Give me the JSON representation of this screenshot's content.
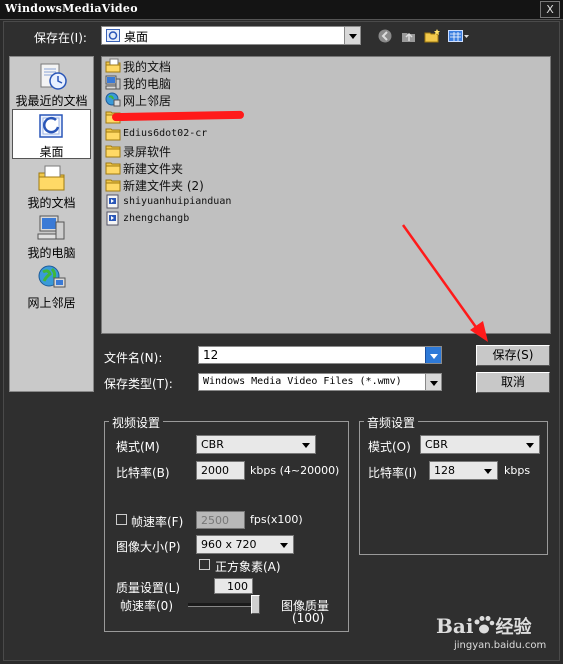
{
  "window": {
    "title": "WindowsMediaVideo",
    "close": "X"
  },
  "save_in": {
    "label": "保存在(I):",
    "value": "桌面",
    "toolbar_icons": [
      "back-arrow-icon",
      "up-folder-icon",
      "new-folder-icon",
      "view-menu-icon"
    ]
  },
  "sidebar": {
    "items": [
      {
        "label": "我最近的文档",
        "icon": "recent-documents-icon"
      },
      {
        "label": "桌面",
        "icon": "desktop-icon",
        "selected": true
      },
      {
        "label": "我的文档",
        "icon": "my-documents-icon"
      },
      {
        "label": "我的电脑",
        "icon": "my-computer-icon"
      },
      {
        "label": "网上邻居",
        "icon": "network-icon"
      }
    ]
  },
  "files": [
    {
      "name": "我的文档",
      "icon": "my-documents-icon"
    },
    {
      "name": "我的电脑",
      "icon": "my-computer-icon"
    },
    {
      "name": "网上邻居",
      "icon": "network-icon"
    },
    {
      "name": "",
      "icon": "folder-icon"
    },
    {
      "name": "Edius6dot02-cr",
      "icon": "folder-icon"
    },
    {
      "name": "录屏软件",
      "icon": "folder-icon"
    },
    {
      "name": "新建文件夹",
      "icon": "folder-icon"
    },
    {
      "name": "新建文件夹 (2)",
      "icon": "folder-icon"
    },
    {
      "name": "shiyuanhuipianduan",
      "icon": "wmv-file-icon"
    },
    {
      "name": "zhengchangb",
      "icon": "wmv-file-icon"
    }
  ],
  "filename": {
    "label": "文件名(N):",
    "value": "12"
  },
  "filetype": {
    "label": "保存类型(T):",
    "value": "Windows Media Video Files (*.wmv)"
  },
  "buttons": {
    "save": "保存(S)",
    "cancel": "取消"
  },
  "video": {
    "title": "视频设置",
    "mode_label": "模式(M)",
    "mode_value": "CBR",
    "bitrate_label": "比特率(B)",
    "bitrate_value": "2000",
    "bitrate_unit": "kbps (4~20000)",
    "framerate_label": "帧速率(F)",
    "framerate_value": "2500",
    "framerate_unit": "fps(x100)",
    "framerate_checked": false,
    "size_label": "图像大小(P)",
    "size_value": "960 x 720",
    "square_pixel_label": "正方象素(A)",
    "square_pixel_checked": false,
    "quality_label": "质量设置(L)",
    "quality_value": "100",
    "slider_left_label": "帧速率(0)",
    "slider_right_label": "图像质量",
    "slider_right_value": "(100)",
    "slider_level": 1.0
  },
  "audio": {
    "title": "音频设置",
    "mode_label": "模式(O)",
    "mode_value": "CBR",
    "bitrate_label": "比特率(I)",
    "bitrate_value": "128",
    "bitrate_unit": "kbps"
  },
  "watermark": {
    "brand": "Bai",
    "suffix": "经验",
    "url": "jingyan.baidu.com"
  },
  "colors": {
    "background": "#2f2f2f",
    "annotation_arrow": "#ff1a1a",
    "accent_dropdown": "#2e7ad8"
  }
}
